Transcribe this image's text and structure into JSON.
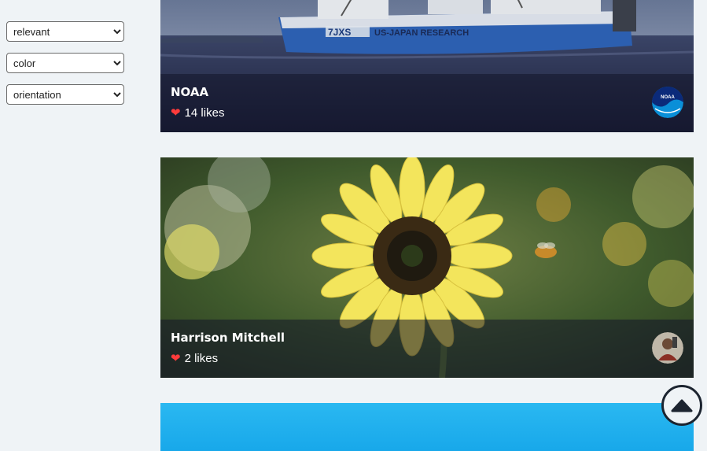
{
  "filters": {
    "relevance": {
      "selected": "relevant",
      "options": [
        "relevant"
      ]
    },
    "color": {
      "selected": "color",
      "options": [
        "color"
      ]
    },
    "orientation": {
      "selected": "orientation",
      "options": [
        "orientation"
      ]
    }
  },
  "photos": [
    {
      "author": "NOAA",
      "likes": "14 likes",
      "ship_name": "7JXS",
      "ship_label": "US-JAPAN RESEARCH",
      "avatar_text": "NOAA"
    },
    {
      "author": "Harrison Mitchell",
      "likes": "2 likes"
    },
    {}
  ],
  "colors": {
    "heart": "#ff3b3b",
    "page_background": "#eff3f6",
    "sky": "#1fb1ee"
  },
  "icons": {
    "like": "heart-icon",
    "scroll_top": "chevron-up-circle-icon"
  }
}
